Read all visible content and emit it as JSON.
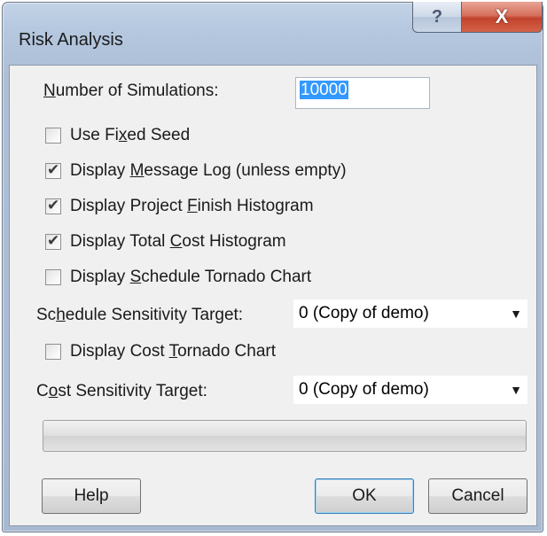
{
  "window": {
    "title": "Risk Analysis",
    "help_glyph": "?",
    "close_glyph": "X"
  },
  "simulations": {
    "label_underlined": "N",
    "label_rest": "umber of Simulations:",
    "value": "10000"
  },
  "checkboxes": [
    {
      "pre": "Use Fi",
      "ul": "x",
      "post": "ed Seed",
      "checked": false
    },
    {
      "pre": "Display ",
      "ul": "M",
      "post": "essage Log (unless empty)",
      "checked": true
    },
    {
      "pre": "Display Project ",
      "ul": "F",
      "post": "inish Histogram",
      "checked": true
    },
    {
      "pre": "Display Total ",
      "ul": "C",
      "post": "ost Histogram",
      "checked": true
    },
    {
      "pre": "Display ",
      "ul": "S",
      "post": "chedule Tornado Chart",
      "checked": false
    }
  ],
  "schedule_target": {
    "pre": "Sc",
    "ul": "h",
    "post": "edule Sensitivity Target:",
    "value": "0 (Copy of demo)"
  },
  "cost_tornado": {
    "pre": "Display Cost ",
    "ul": "T",
    "post": "ornado Chart",
    "checked": false
  },
  "cost_target": {
    "pre": "C",
    "ul": "o",
    "post": "st Sensitivity Target:",
    "value": "0 (Copy of demo)"
  },
  "progress": {
    "fraction": 0,
    "color": "#37b44a"
  },
  "buttons": {
    "help": "Help",
    "ok": "OK",
    "cancel": "Cancel"
  },
  "icons": {
    "dropdown": "chevron-down-icon",
    "check": "checkmark-icon"
  }
}
